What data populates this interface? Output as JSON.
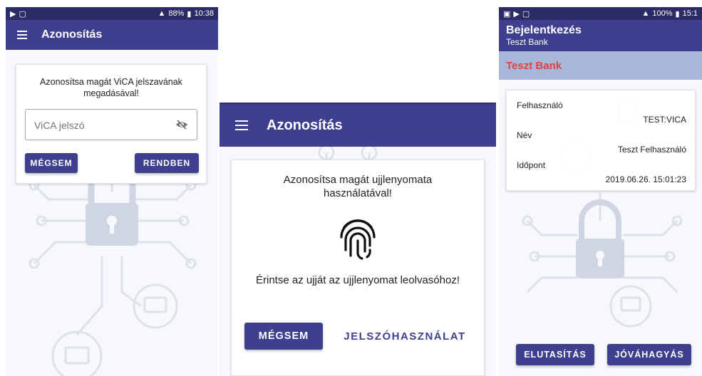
{
  "colors": {
    "primary": "#3f3f8f",
    "bank_strip": "#a7b7dc",
    "bank_name": "#e0433a",
    "background": "#f7f8fb"
  },
  "screen1": {
    "status": {
      "time": "10:38",
      "battery": "88%"
    },
    "title": "Azonosítás",
    "prompt": "Azonosítsa magát ViCA jelszavának megadásával!",
    "password_placeholder": "ViCA jelszó",
    "cancel_label": "MÉGSEM",
    "ok_label": "RENDBEN",
    "icons": {
      "menu": "hamburger-icon",
      "visibility": "eye-off-icon"
    }
  },
  "screen2": {
    "title": "Azonosítás",
    "prompt": "Azonosítsa magát ujjlenyomata használatával!",
    "instruction": "Érintse az ujját az ujjlenyomat leolvasóhoz!",
    "cancel_label": "MÉGSEM",
    "password_label": "JELSZÓHASZNÁLAT",
    "icons": {
      "menu": "hamburger-icon",
      "fingerprint": "fingerprint-icon"
    }
  },
  "screen3": {
    "status": {
      "time": "15:1",
      "battery": "100%"
    },
    "title": "Bejelentkezés",
    "subtitle": "Teszt Bank",
    "bank_name": "Teszt Bank",
    "fields": [
      {
        "label": "Felhasználó",
        "value": "TEST:VICA"
      },
      {
        "label": "Név",
        "value": "Teszt Felhasználó"
      },
      {
        "label": "Időpont",
        "value": "2019.06.26. 15:01:23"
      }
    ],
    "reject_label": "ELUTASÍTÁS",
    "approve_label": "JÓVÁHAGYÁS"
  }
}
